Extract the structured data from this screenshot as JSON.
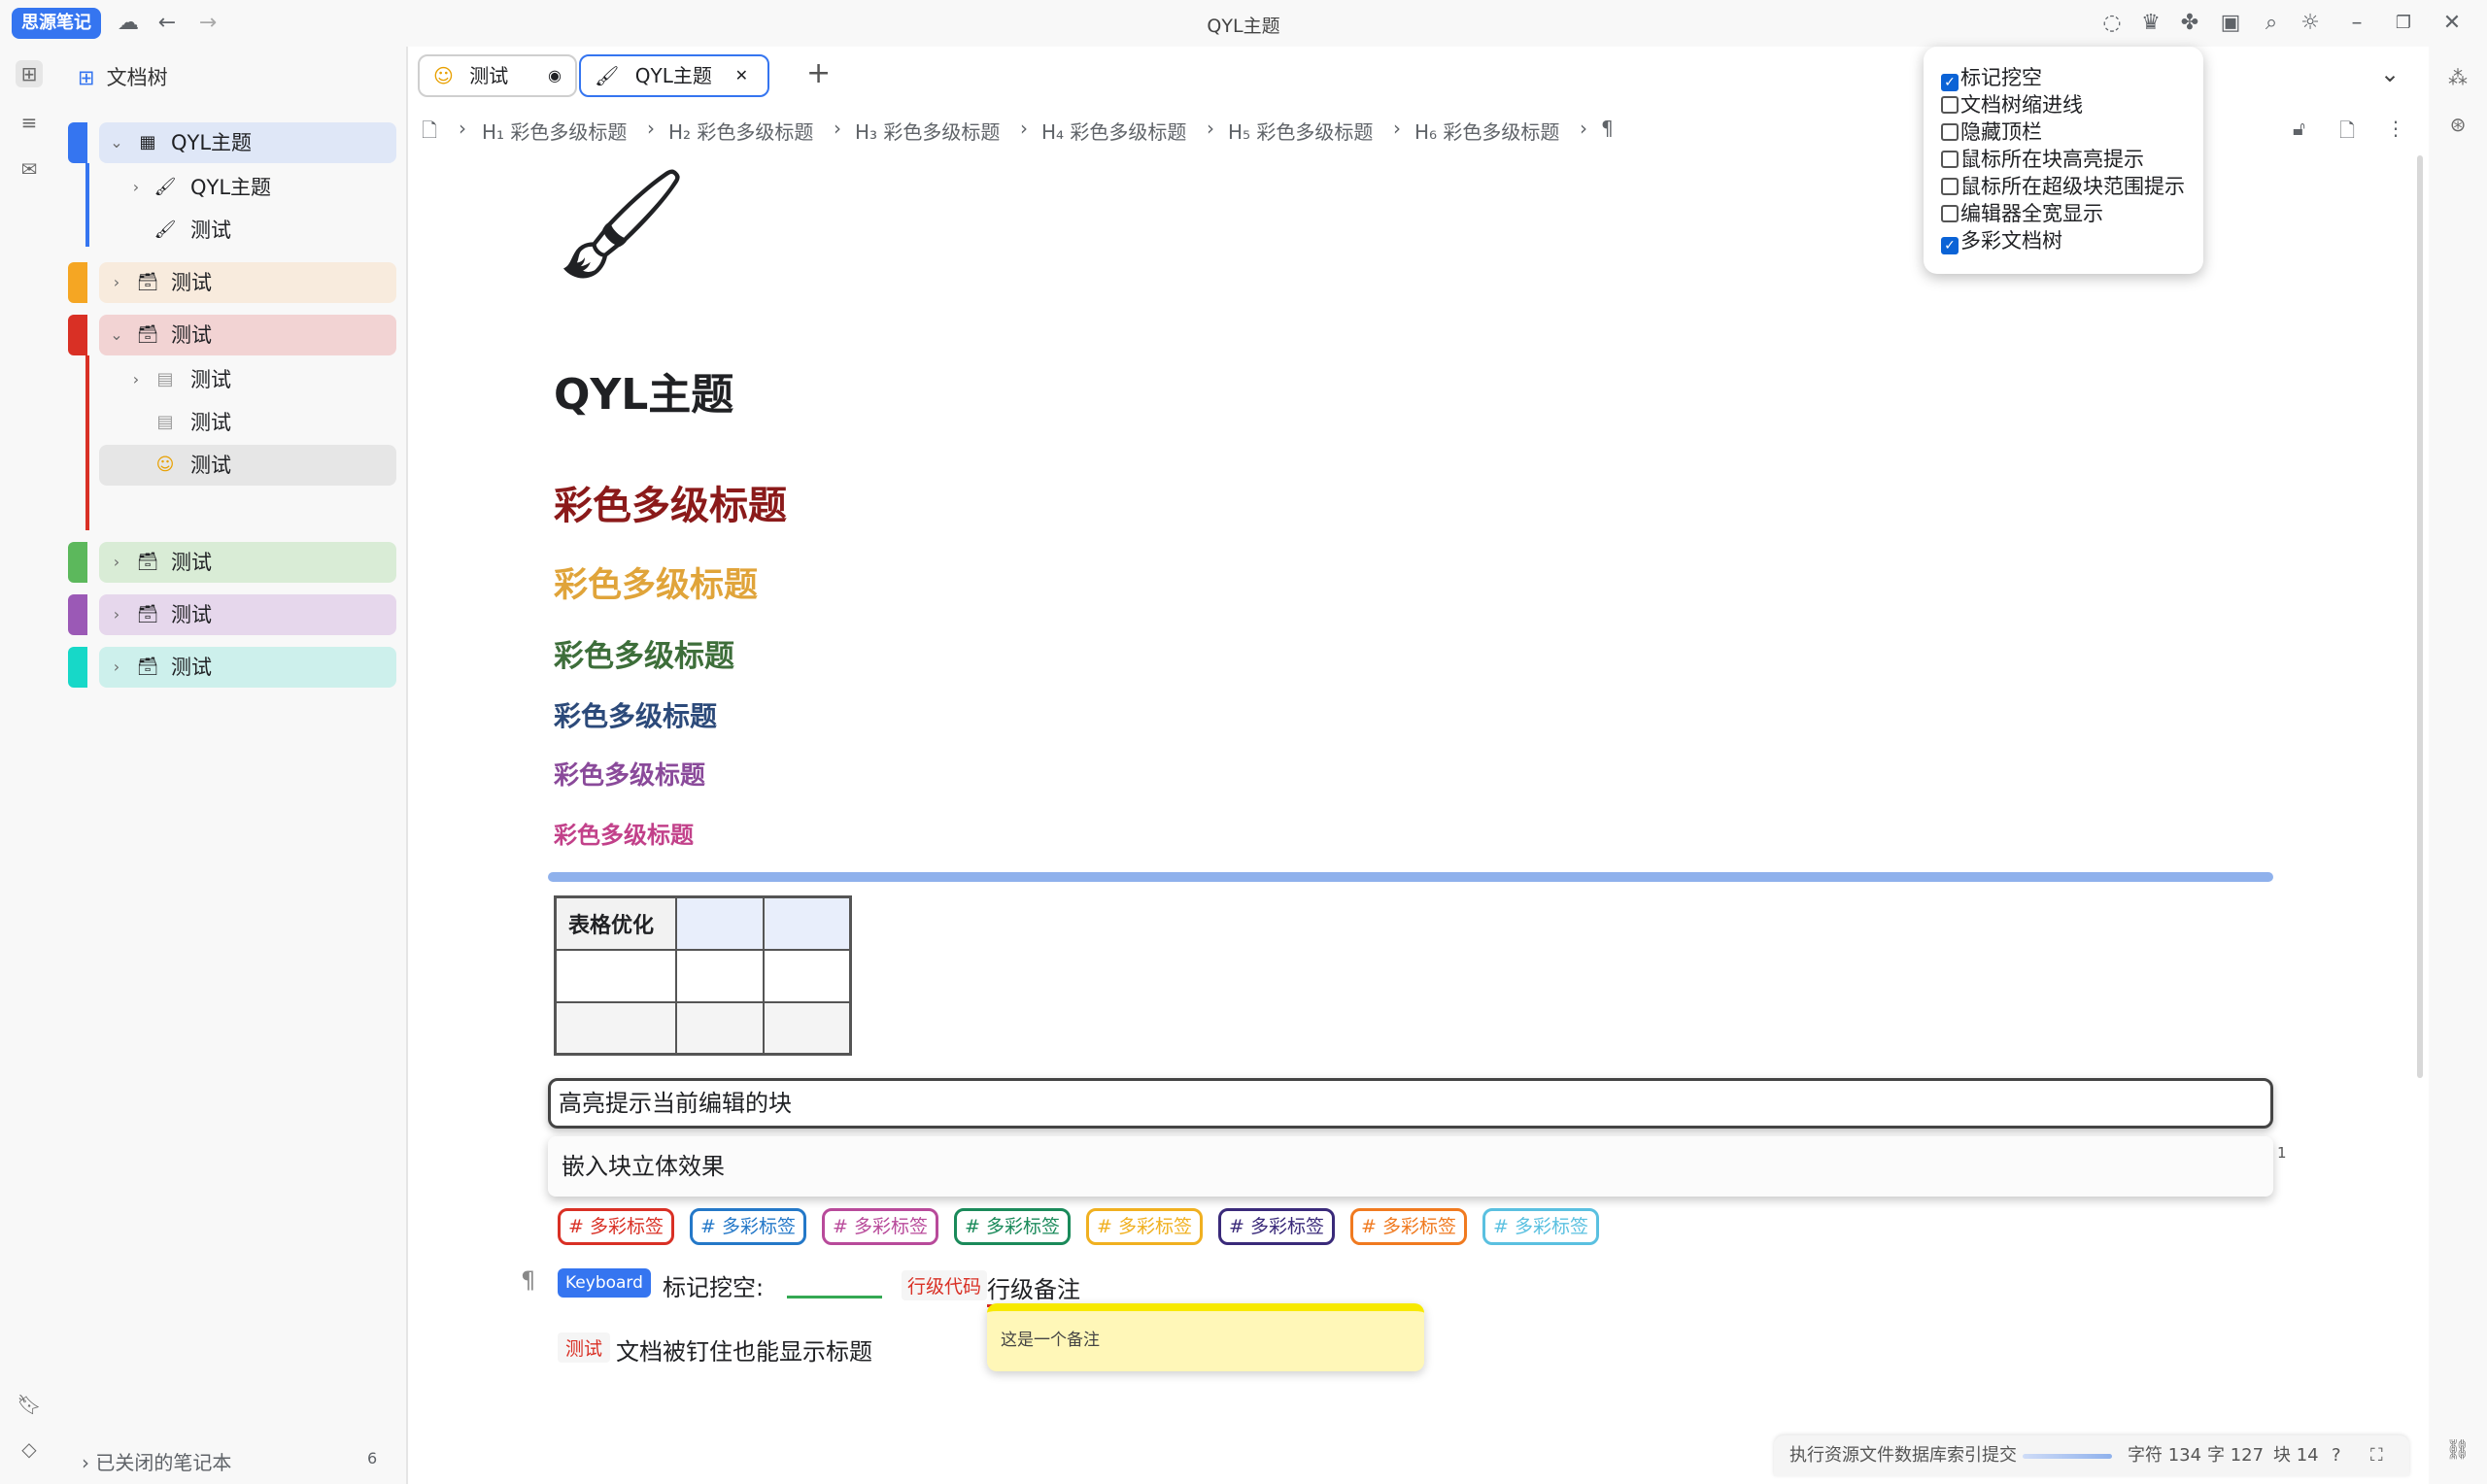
{
  "app": {
    "logo": "思源笔记",
    "window_title": "QYL主题"
  },
  "filetree": {
    "header": "文档树",
    "items": [
      {
        "label": "QYL主题",
        "icon": "box-icon",
        "color": "#3575f0",
        "expanded": true
      },
      {
        "label": "QYL主题",
        "icon": "brush-icon"
      },
      {
        "label": "测试",
        "icon": "brush-icon"
      },
      {
        "label": "测试",
        "icon": "archive-icon",
        "color": "#f5a623"
      },
      {
        "label": "测试",
        "icon": "archive-icon",
        "color": "#d93025",
        "expanded": true
      },
      {
        "label": "测试",
        "icon": "doc-icon"
      },
      {
        "label": "测试",
        "icon": "doc-icon"
      },
      {
        "label": "测试",
        "icon": "smile-icon"
      },
      {
        "label": "测试",
        "icon": "archive-icon",
        "color": "#5cb85c"
      },
      {
        "label": "测试",
        "icon": "archive-icon",
        "color": "#9b59b6"
      },
      {
        "label": "测试",
        "icon": "archive-icon",
        "color": "#17d8c8"
      }
    ],
    "closed_notebooks": "已关闭的笔记本",
    "closed_count": "6"
  },
  "tabs": [
    {
      "label": "测试",
      "icon": "smile-icon"
    },
    {
      "label": "QYL主题",
      "icon": "brush-icon",
      "active": true
    }
  ],
  "breadcrumb": [
    "H₁ 彩色多级标题",
    "H₂ 彩色多级标题",
    "H₃ 彩色多级标题",
    "H₄ 彩色多级标题",
    "H₅ 彩色多级标题",
    "H₆ 彩色多级标题"
  ],
  "doc": {
    "title": "QYL主题",
    "headings": [
      {
        "text": "彩色多级标题",
        "color": "#8b1a1a"
      },
      {
        "text": "彩色多级标题",
        "color": "#e0a43a"
      },
      {
        "text": "彩色多级标题",
        "color": "#3d6e3a"
      },
      {
        "text": "彩色多级标题",
        "color": "#2c4a7a"
      },
      {
        "text": "彩色多级标题",
        "color": "#8a4a9a"
      },
      {
        "text": "彩色多级标题",
        "color": "#c2418a"
      }
    ],
    "table_header": "表格优化",
    "highlight_block": "高亮提示当前编辑的块",
    "embed_block": "嵌入块立体效果",
    "embed_count": "1",
    "tags": [
      {
        "text": "# 多彩标签",
        "color": "#d93025"
      },
      {
        "text": "# 多彩标签",
        "color": "#2478c8"
      },
      {
        "text": "# 多彩标签",
        "color": "#b84a9a"
      },
      {
        "text": "# 多彩标签",
        "color": "#1a8a5a"
      },
      {
        "text": "# 多彩标签",
        "color": "#f0b020"
      },
      {
        "text": "# 多彩标签",
        "color": "#3a2a7a"
      },
      {
        "text": "# 多彩标签",
        "color": "#f07a20"
      },
      {
        "text": "# 多彩标签",
        "color": "#5ac0e0"
      }
    ],
    "keyboard": "Keyboard",
    "mark_label": "标记挖空:",
    "inline_code": "行级代码",
    "memo": "行级备注",
    "memo_popup": "这是一个备注",
    "pinned_badge": "测试",
    "pinned_text": "文档被钉住也能显示标题"
  },
  "settings": {
    "options": [
      {
        "label": "标记挖空",
        "checked": true
      },
      {
        "label": "文档树缩进线",
        "checked": false
      },
      {
        "label": "隐藏顶栏",
        "checked": false
      },
      {
        "label": "鼠标所在块高亮提示",
        "checked": false
      },
      {
        "label": "鼠标所在超级块范围提示",
        "checked": false
      },
      {
        "label": "编辑器全宽显示",
        "checked": false
      },
      {
        "label": "多彩文档树",
        "checked": true
      }
    ]
  },
  "statusbar": {
    "task": "执行资源文件数据库索引提交",
    "chars": "字符 134",
    "words": "字 127",
    "blocks": "块 14"
  }
}
